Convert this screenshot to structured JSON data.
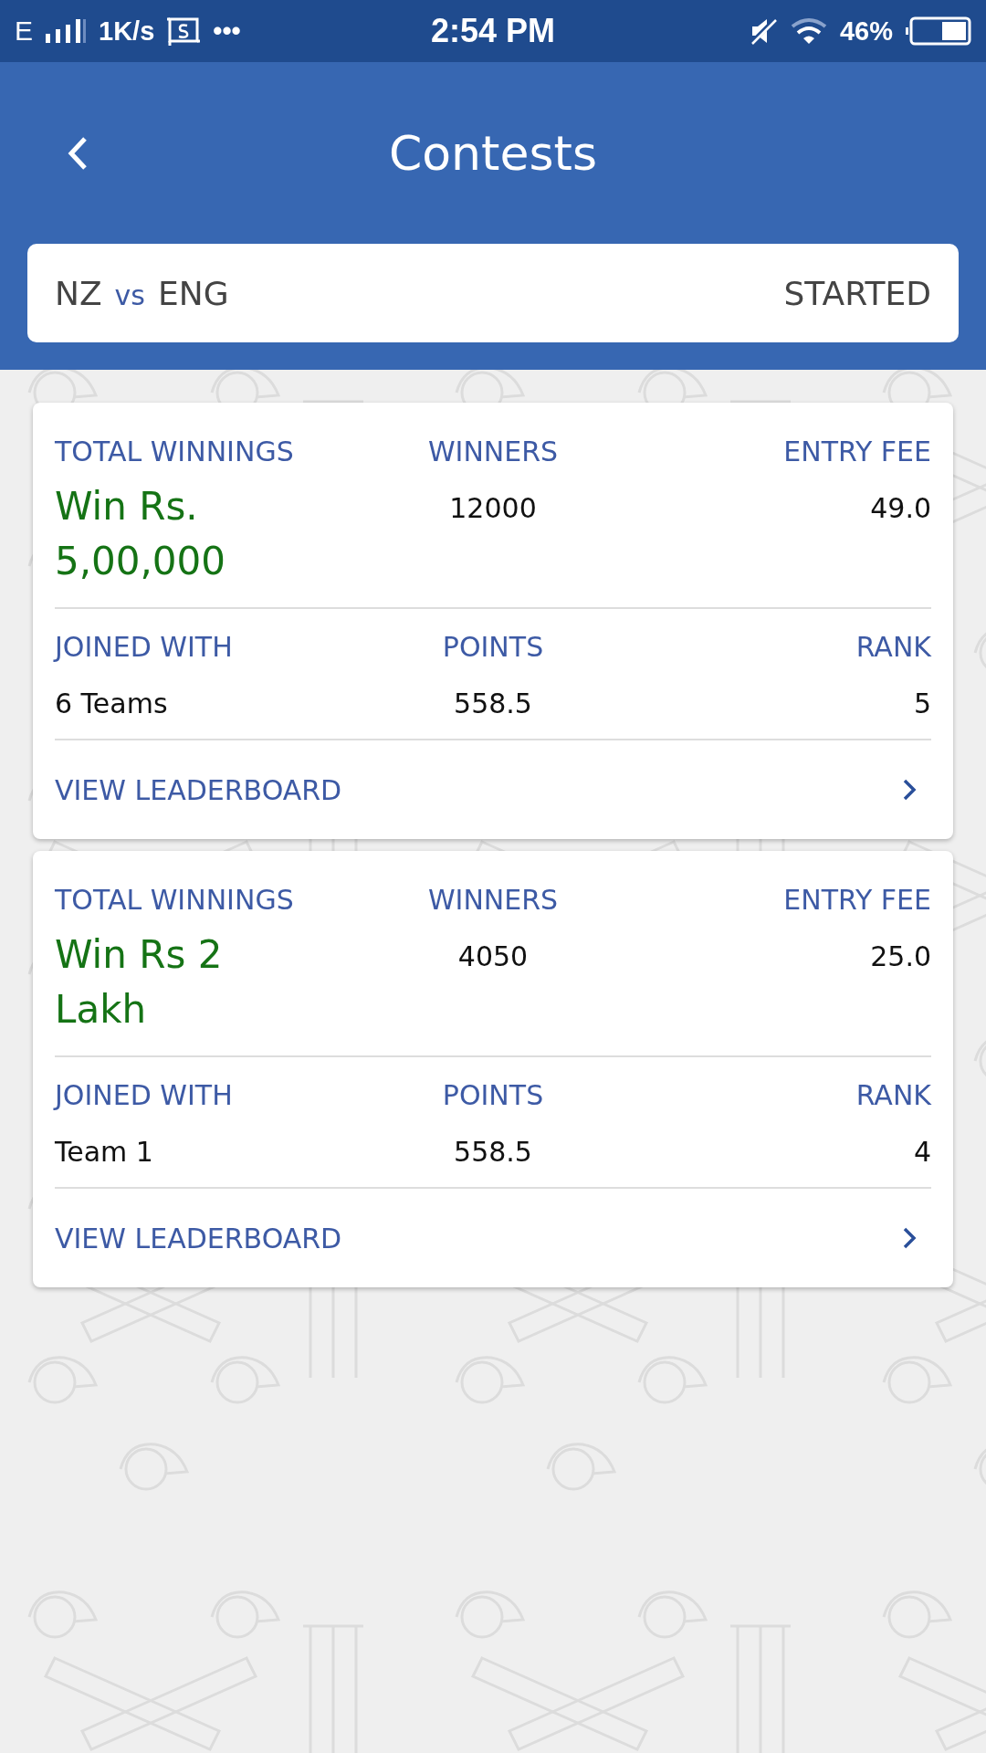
{
  "status_bar": {
    "network": "E",
    "speed": "1K/s",
    "more": "•••",
    "time": "2:54 PM",
    "battery": "46%"
  },
  "header": {
    "title": "Contests"
  },
  "match": {
    "team_1": "NZ",
    "separator": "vs",
    "team_2": "ENG",
    "status": "STARTED"
  },
  "contests": [
    {
      "total_winnings_label": "TOTAL WINNINGS",
      "prize": "Win Rs. 5,00,000",
      "winners_label": "WINNERS",
      "winners": "12000",
      "entry_fee_label": "ENTRY FEE",
      "entry_fee": "49.0",
      "joined_label": "JOINED WITH",
      "joined": "6 Teams",
      "points_label": "POINTS",
      "points": "558.5",
      "rank_label": "RANK",
      "rank": "5",
      "action": "VIEW LEADERBOARD"
    },
    {
      "total_winnings_label": "TOTAL WINNINGS",
      "prize": "Win Rs 2 Lakh",
      "winners_label": "WINNERS",
      "winners": "4050",
      "entry_fee_label": "ENTRY FEE",
      "entry_fee": "25.0",
      "joined_label": "JOINED WITH",
      "joined": "Team 1",
      "points_label": "POINTS",
      "points": "558.5",
      "rank_label": "RANK",
      "rank": "4",
      "action": "VIEW LEADERBOARD"
    }
  ]
}
